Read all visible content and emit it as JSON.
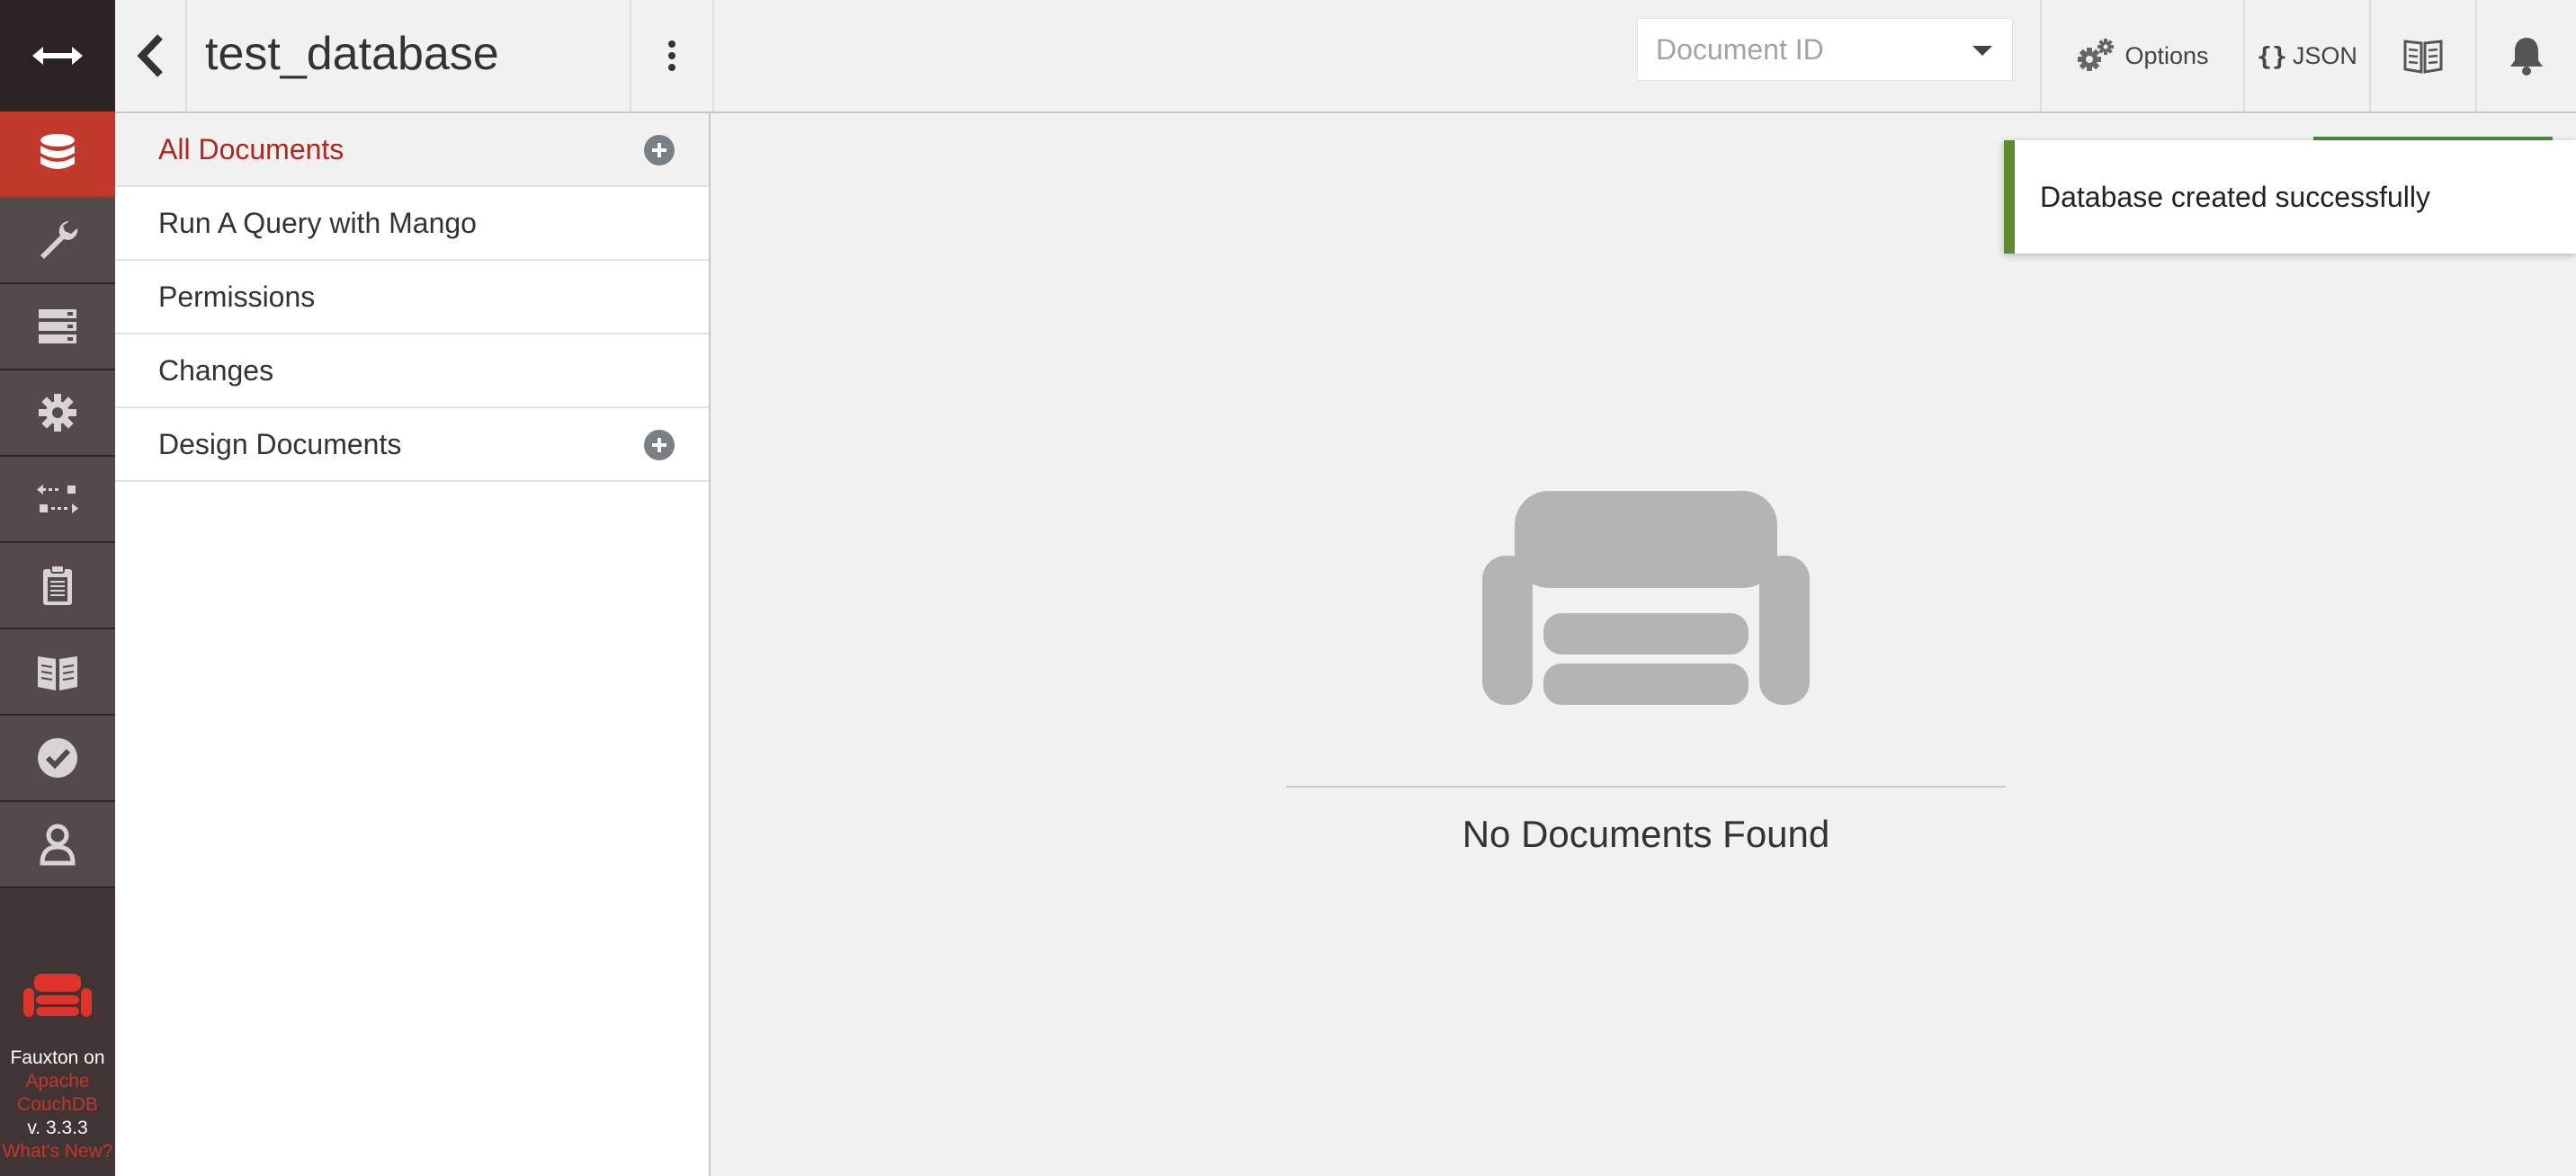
{
  "header": {
    "database_name": "test_database",
    "doc_id_placeholder": "Document ID",
    "options_label": "Options",
    "json_label": "JSON"
  },
  "rail": {
    "items": [
      {
        "icon": "database-icon",
        "active": true
      },
      {
        "icon": "wrench-icon",
        "active": false
      },
      {
        "icon": "server-icon",
        "active": false
      },
      {
        "icon": "gear-icon",
        "active": false
      },
      {
        "icon": "replication-icon",
        "active": false
      },
      {
        "icon": "clipboard-icon",
        "active": false
      },
      {
        "icon": "book-icon",
        "active": false
      },
      {
        "icon": "check-circle-icon",
        "active": false
      },
      {
        "icon": "user-icon",
        "active": false
      }
    ],
    "footer": {
      "line1": "Fauxton on",
      "line2": "Apache",
      "line3": "CouchDB",
      "version": "v. 3.3.3",
      "whats_new": "What's New?"
    }
  },
  "sidebar": {
    "items": [
      {
        "label": "All Documents",
        "active": true,
        "has_add": true
      },
      {
        "label": "Run A Query with Mango",
        "active": false,
        "has_add": false
      },
      {
        "label": "Permissions",
        "active": false,
        "has_add": false
      },
      {
        "label": "Changes",
        "active": false,
        "has_add": false
      },
      {
        "label": "Design Documents",
        "active": false,
        "has_add": true
      }
    ]
  },
  "main": {
    "empty_message": "No Documents Found"
  },
  "toast": {
    "message": "Database created successfully",
    "status_color": "#5b8b2e"
  },
  "colors": {
    "accent": "#c0392b",
    "rail_bg": "#403434"
  }
}
